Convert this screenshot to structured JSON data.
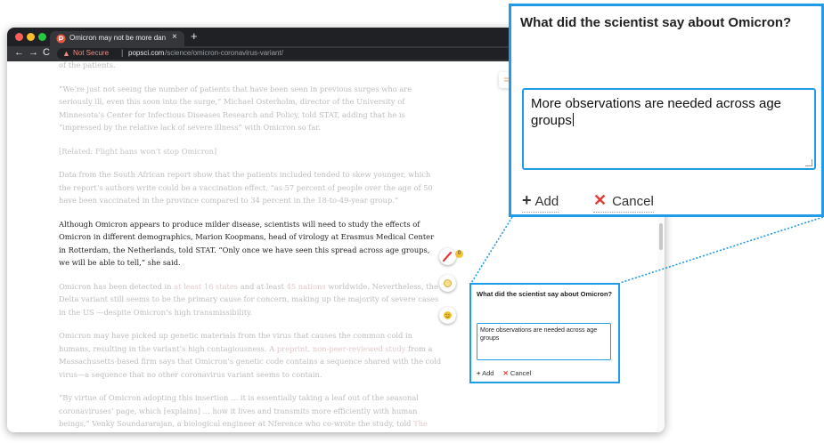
{
  "browser": {
    "tab_title": "Omicron may not be more dan",
    "tab_close": "×",
    "new_tab": "+",
    "nav_back": "←",
    "nav_forward": "→",
    "nav_reload": "C",
    "security_label": "Not Secure",
    "url_host": "popsci.com",
    "url_path": "/science/omicron-coronavirus-variant/"
  },
  "article": {
    "p0": "of the patients.",
    "p1": "“We’re just not seeing the number of patients that have been seen in previous surges who are seriously ill, even this soon into the surge,” Michael Osterholm, director of the University of Minnesota’s Center for Infectious Diseases Research and Policy, told STAT, adding that he is “impressed by the relative lack of severe illness” with Omicron so far.",
    "related": "[Related: Flight bans won’t stop Omicron]",
    "p2": "Data from the South African report show that the patients included tended to skew younger, which the report’s authors write could be a vaccination effect, “as 57 percent of people over the age of 50 have been vaccinated in the province compared to 34 percent in the 18-to-49-year group.”",
    "p3": "Although Omicron appears to produce milder disease, scientists will need to study the effects of Omicron in different demographics, Marion Koopmans, head of virology at Erasmus Medical Center in Rotterdam, the Netherlands, told STAT. “Only once we have seen this spread across age groups, we will be able to tell,” she said.",
    "p4_a": "Omicron has been detected in ",
    "p4_link1": "at least 16 states",
    "p4_b": " and at least ",
    "p4_link2": "45 nations",
    "p4_c": " worldwide. Nevertheless, the Delta variant still seems to be the primary cause for concern, making up the majority of severe cases in the US —despite Omicron’s high transmissibility.",
    "p5_a": "Omicron may have picked up genetic materials from the virus that causes the common cold in humans, resulting in the variant’s high contagiousness. A ",
    "p5_link": "preprint, non-peer-reviewed study",
    "p5_b": " from a Massachusetts-based firm says that Omicron’s genetic code contains a sequence shared with the cold virus—a sequence that no other coronavirus variant seems to contain.",
    "p6_a": "“By virtue of Omicron adopting this insertion … it is essentially taking a leaf out of the seasonal coronaviruses’ page, which [explains] … how it lives and transmits more efficiently with human beings,” Venky Soundararajan, a biological engineer at Nference who co-wrote the study, told ",
    "p6_link": "The Washington"
  },
  "tools": {
    "badge_count": "0"
  },
  "form": {
    "question": "What did the scientist say about Omicron?",
    "answer": "More observations are needed across age groups",
    "add_plus": "+",
    "add_label": "Add",
    "cancel_x": "✕",
    "cancel_label": "Cancel"
  },
  "colors": {
    "accent": "#1e9be9",
    "cancel_red": "#e53935"
  }
}
